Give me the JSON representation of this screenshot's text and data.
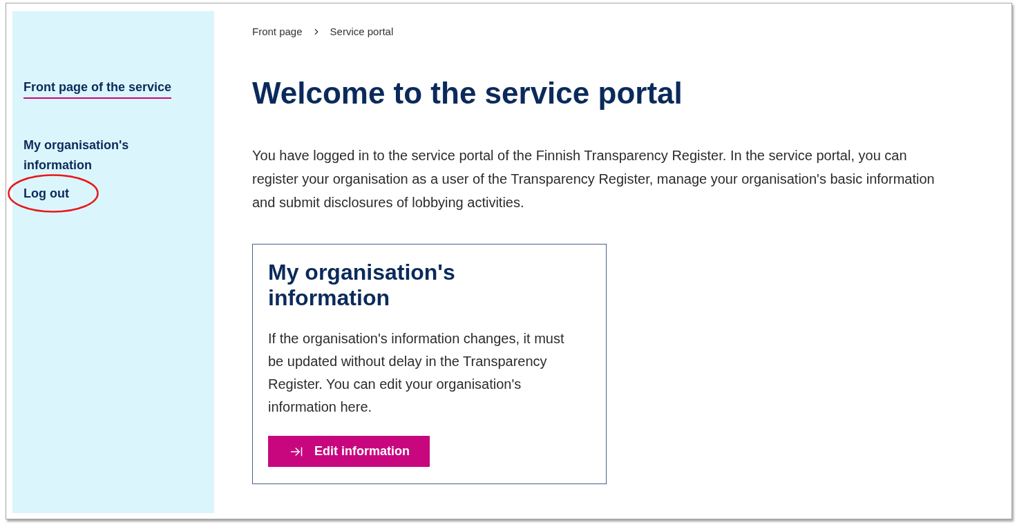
{
  "sidebar": {
    "items": [
      {
        "label": "Front page of the service",
        "selected": true,
        "highlighted": false
      },
      {
        "label": "My organisation's information",
        "selected": false,
        "highlighted": false
      },
      {
        "label": "Log out",
        "selected": false,
        "highlighted": true
      }
    ]
  },
  "breadcrumb": [
    "Front page",
    "Service portal"
  ],
  "page": {
    "title": "Welcome to the service portal",
    "intro": "You have logged in to the service portal of the Finnish Transparency Register. In the service portal, you can register your organisation as a user of the Transparency Register, manage your organisation's basic information and submit disclosures of lobbying activities."
  },
  "card": {
    "title": "My organisation's information",
    "text": "If the organisation's information changes, it must be updated without delay in the Transparency Register. You can edit your organisation's information here.",
    "button": "Edit information"
  }
}
